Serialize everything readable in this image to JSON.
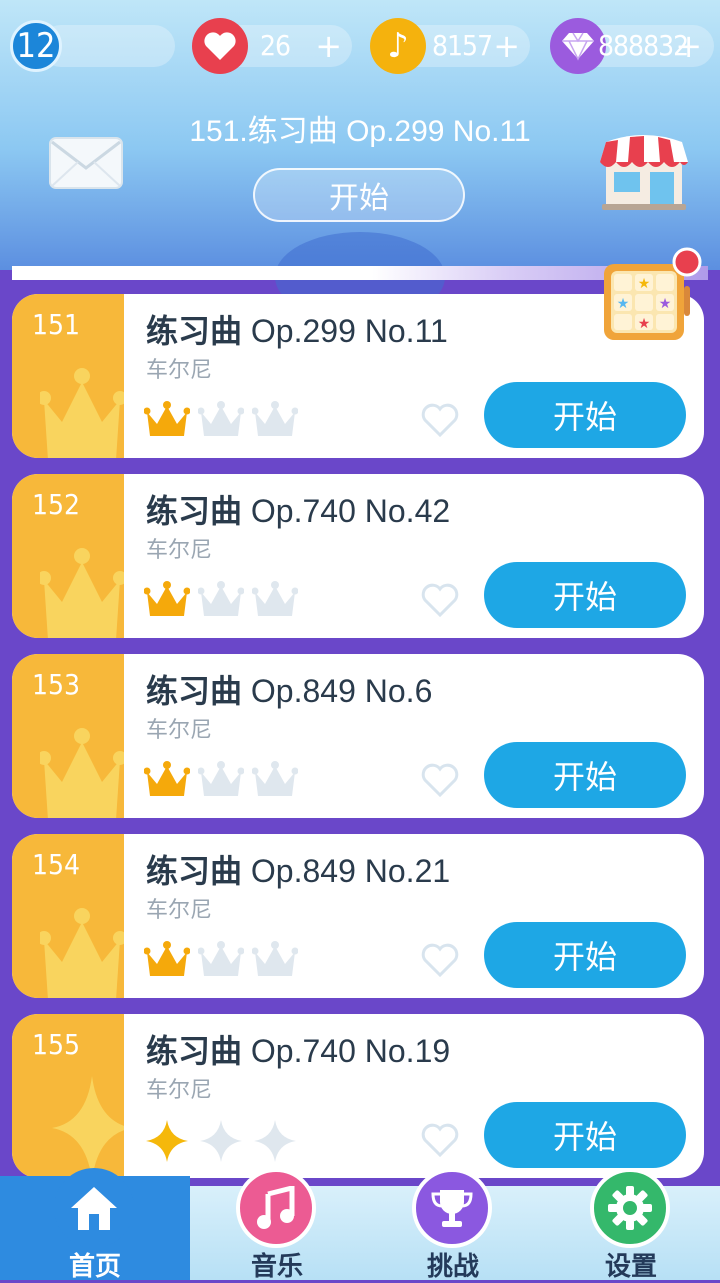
{
  "status": {
    "level": "12",
    "lives": "26",
    "notes": "8157",
    "gems": "888832",
    "plus": "+"
  },
  "featured": {
    "title": "151.练习曲 Op.299 No.11",
    "start_label": "开始"
  },
  "songs": [
    {
      "number": "151",
      "title_zh": "练习曲",
      "title_op": " Op.299 No.11",
      "composer": "车尔尼",
      "rating": 1,
      "rating_icon": "crown",
      "start_label": "开始"
    },
    {
      "number": "152",
      "title_zh": "练习曲",
      "title_op": " Op.740 No.42",
      "composer": "车尔尼",
      "rating": 1,
      "rating_icon": "crown",
      "start_label": "开始"
    },
    {
      "number": "153",
      "title_zh": "练习曲",
      "title_op": " Op.849 No.6",
      "composer": "车尔尼",
      "rating": 1,
      "rating_icon": "crown",
      "start_label": "开始"
    },
    {
      "number": "154",
      "title_zh": "练习曲",
      "title_op": " Op.849 No.21",
      "composer": "车尔尼",
      "rating": 1,
      "rating_icon": "crown",
      "start_label": "开始"
    },
    {
      "number": "155",
      "title_zh": "练习曲",
      "title_op": " Op.740 No.19",
      "composer": "车尔尼",
      "rating": 1,
      "rating_icon": "sparkle",
      "start_label": "开始"
    }
  ],
  "nav": {
    "home": "首页",
    "music": "音乐",
    "challenge": "挑战",
    "settings": "设置"
  },
  "colors": {
    "accent_blue": "#1ea7e5",
    "gold": "#f7b83a",
    "purple_bg": "#6a47c9",
    "heart_red": "#e8404e",
    "note_yellow": "#f5b20d",
    "gem_purple": "#9b5bde"
  }
}
